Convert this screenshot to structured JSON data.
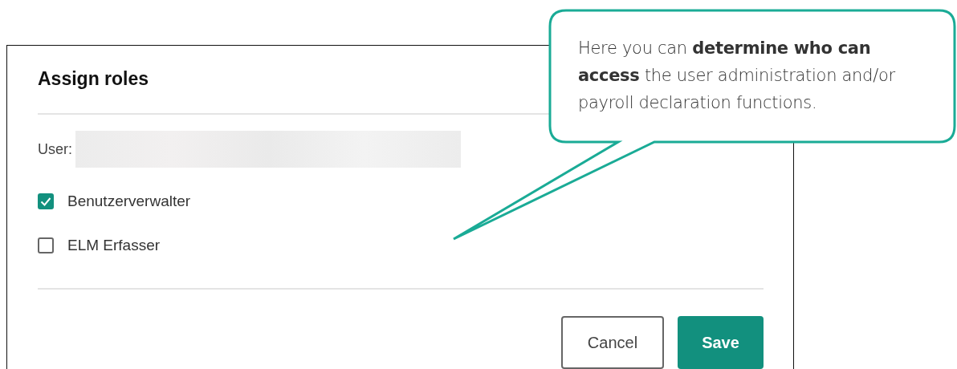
{
  "dialog": {
    "title": "Assign roles",
    "user_label": "User:",
    "user_value": {
      "kind": "redacted"
    },
    "roles": [
      {
        "label": "Benutzerverwalter",
        "checked": true
      },
      {
        "label": "ELM Erfasser",
        "checked": false
      }
    ],
    "buttons": [
      {
        "label": "Cancel",
        "kind": "secondary"
      },
      {
        "label": "Save",
        "kind": "primary"
      }
    ]
  },
  "callout": {
    "text": "Here you can **determine who can access** the user administration and/or payroll declaration functions."
  }
}
